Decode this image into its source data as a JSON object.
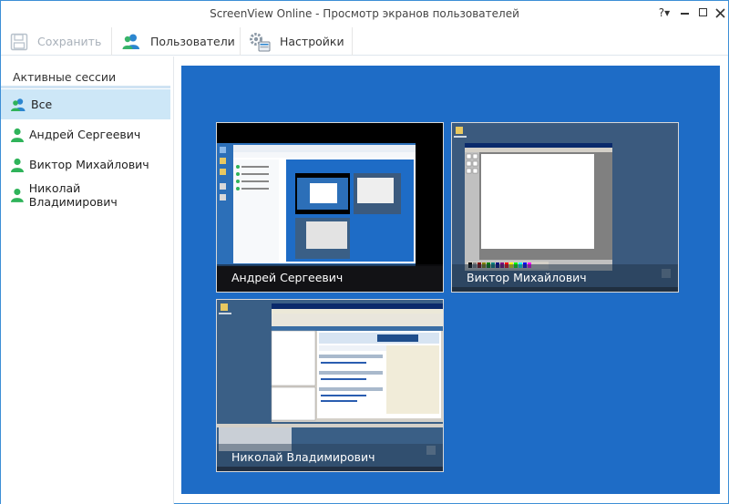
{
  "window": {
    "title": "ScreenView Online - Просмотр экранов пользователей",
    "help_label": "?▾"
  },
  "toolbar": {
    "save_label": "Сохранить",
    "users_label": "Пользователи",
    "settings_label": "Настройки"
  },
  "sidebar": {
    "header": "Активные сессии",
    "items": [
      {
        "label": "Все",
        "icon": "users-group-icon",
        "selected": true
      },
      {
        "label": "Андрей Сергеевич",
        "icon": "user-icon"
      },
      {
        "label": "Виктор Михайлович",
        "icon": "user-icon"
      },
      {
        "label": "Николай Владимирович",
        "icon": "user-icon"
      }
    ]
  },
  "sessions": [
    {
      "user": "Андрей Сергеевич"
    },
    {
      "user": "Виктор Михайлович"
    },
    {
      "user": "Николай Владимирович"
    }
  ],
  "colors": {
    "accent": "#3d8fd6",
    "viewer_bg": "#1e6cc6",
    "selected_bg": "#cde7f7",
    "user_icon": "#2fb35a"
  }
}
